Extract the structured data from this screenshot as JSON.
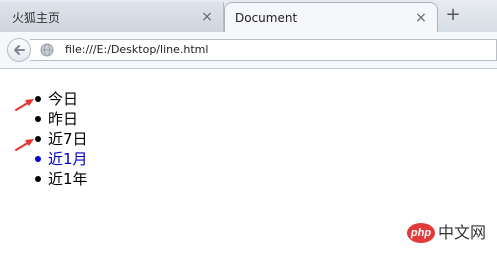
{
  "browser": {
    "tabs": [
      {
        "title": "火狐主页",
        "active": false
      },
      {
        "title": "Document",
        "active": true
      }
    ],
    "close_glyph": "×",
    "new_tab_glyph": "+",
    "url": "file:///E:/Desktop/line.html"
  },
  "page": {
    "items": [
      {
        "label": "今日",
        "highlight": false,
        "arrow": true
      },
      {
        "label": "昨日",
        "highlight": false,
        "arrow": false
      },
      {
        "label": "近7日",
        "highlight": false,
        "arrow": true
      },
      {
        "label": "近1月",
        "highlight": true,
        "arrow": false
      },
      {
        "label": "近1年",
        "highlight": false,
        "arrow": false
      }
    ]
  },
  "watermark": {
    "badge": "php",
    "text": "中文网"
  },
  "colors": {
    "highlight": "#0000cc",
    "arrow": "#e8322e"
  }
}
